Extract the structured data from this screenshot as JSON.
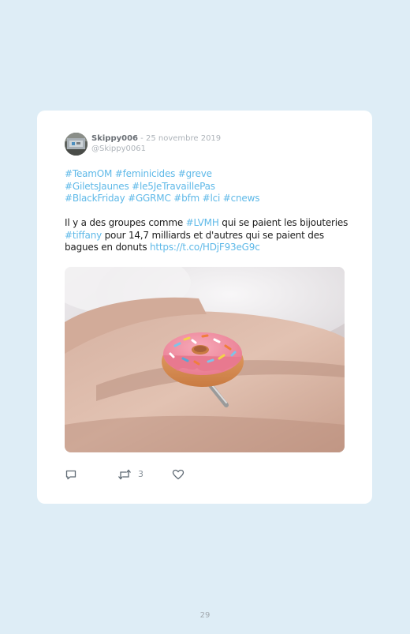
{
  "tweet": {
    "username": "Skippy006",
    "separator": " - ",
    "date": "25 novembre 2019",
    "handle": "@Skippy0061",
    "hashtag_lines": [
      "#TeamOM #feminicides #greve",
      "#GiletsJaunes #le5JeTravaillePas",
      "#BlackFriday #GGRMC #bfm #lci #cnews"
    ],
    "body": {
      "part1": "Il y a des groupes comme ",
      "tag1": "#LVMH",
      "part2": " qui se paient les bijouteries ",
      "tag2": "#tiffany",
      "part3": " pour 14,7 milliards et d'autres qui se paient des bagues en donuts ",
      "link": "https://t.co/HDjF93eG9c"
    },
    "retweet_count": "3"
  },
  "icons": {
    "reply": "reply-icon",
    "retweet": "retweet-icon",
    "like": "heart-icon"
  },
  "colors": {
    "page_background": "#deedf6",
    "card_background": "#ffffff",
    "link": "#5fb9e8",
    "text": "#1d1d1d",
    "muted": "#aeb4ba"
  },
  "page_number": "29"
}
